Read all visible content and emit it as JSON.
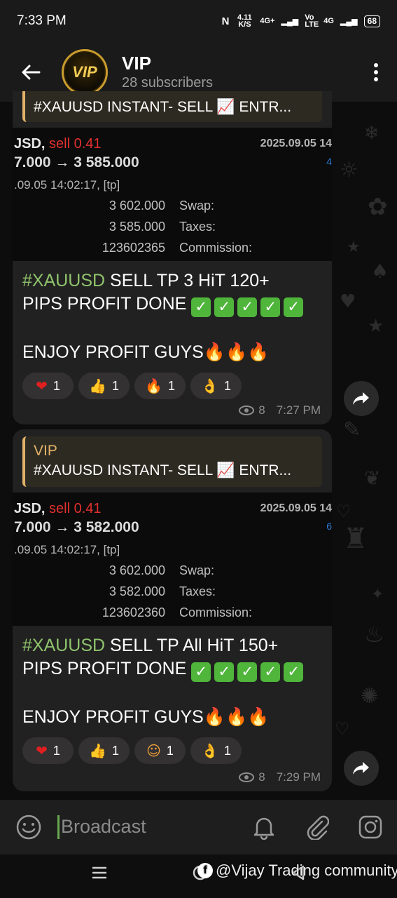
{
  "status": {
    "time": "7:33 PM",
    "speed": "4.11 K/S",
    "net1": "4G+",
    "volte": "Vo LTE",
    "net2": "4G",
    "battery": "68"
  },
  "header": {
    "title": "VIP",
    "subtitle": "28 subscribers",
    "avatar_text": "VIP"
  },
  "messages": [
    {
      "reply_name": "",
      "reply_text": "#XAUUSD INSTANT- SELL 📈  ENTR...",
      "shot": {
        "sym": "JSD,",
        "sell": "sell 0.41",
        "date": "2025.09.05 14",
        "range": "7.000 → 3 585.000",
        "time": ".09.05 14:02:17, [tp]",
        "v1": "3 602.000",
        "k1": "Swap:",
        "v2": "3 585.000",
        "k2": "Taxes:",
        "v3": "123602365",
        "k3": "Commission:",
        "edge": "4"
      },
      "tag": "#XAUUSD",
      "text1": " SELL TP 3 HiT 120+",
      "text2": "PIPS  PROFIT DONE",
      "text3": "ENJOY PROFIT GUYS",
      "reactions": [
        {
          "icon": "heart",
          "count": "1"
        },
        {
          "icon": "thumbs-up",
          "count": "1"
        },
        {
          "icon": "fire",
          "count": "1"
        },
        {
          "icon": "ok-hand",
          "count": "1"
        }
      ],
      "views": "8",
      "time": "7:27 PM"
    },
    {
      "reply_name": "VIP",
      "reply_text": "#XAUUSD INSTANT- SELL 📈  ENTR...",
      "shot": {
        "sym": "JSD,",
        "sell": "sell 0.41",
        "date": "2025.09.05 14",
        "range": "7.000 → 3 582.000",
        "time": ".09.05 14:02:17, [tp]",
        "v1": "3 602.000",
        "k1": "Swap:",
        "v2": "3 582.000",
        "k2": "Taxes:",
        "v3": "123602360",
        "k3": "Commission:",
        "edge": "6"
      },
      "tag": "#XAUUSD",
      "text1": " SELL TP All HiT 150+",
      "text2": "PIPS  PROFIT DONE",
      "text3": "ENJOY PROFIT GUYS",
      "reactions": [
        {
          "icon": "heart",
          "count": "1"
        },
        {
          "icon": "thumbs-up",
          "count": "1"
        },
        {
          "icon": "smiling-face-with-hearts",
          "count": "1"
        },
        {
          "icon": "ok-hand",
          "count": "1"
        }
      ],
      "views": "8",
      "time": "7:29 PM"
    }
  ],
  "input": {
    "placeholder": "Broadcast"
  },
  "watermark": "@Vijay Trading community",
  "colors": {
    "accent_green": "#8fc36c",
    "reply_bar": "#e3b268",
    "sell_red": "#e0302e",
    "bubble": "#212121"
  }
}
